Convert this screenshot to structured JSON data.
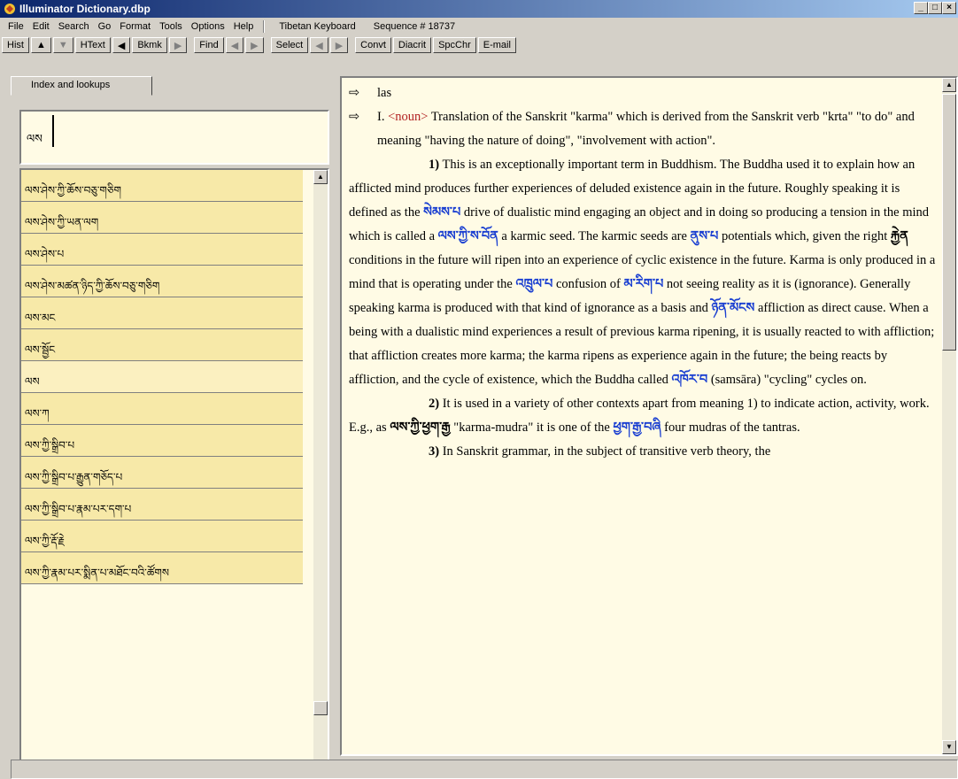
{
  "window": {
    "title": "Illuminator Dictionary.dbp",
    "min": "_",
    "max": "□",
    "close": "×"
  },
  "menu": {
    "items": [
      "File",
      "Edit",
      "Search",
      "Go",
      "Format",
      "Tools",
      "Options",
      "Help"
    ],
    "keyboard": "Tibetan Keyboard",
    "sequence": "Sequence # 18737"
  },
  "toolbar": {
    "hist": "Hist",
    "up": "▲",
    "down": "▼",
    "htext": "HText",
    "back": "◀",
    "bkmk": "Bkmk",
    "fwd": "▶",
    "find": "Find",
    "find_prev": "◀",
    "find_next": "▶",
    "select": "Select",
    "sel_prev": "◀",
    "sel_next": "▶",
    "convt": "Convt",
    "diacrit": "Diacrit",
    "spcchr": "SpcChr",
    "email": "E-mail"
  },
  "left": {
    "tab": "Index and lookups",
    "search_value": "ལས",
    "items": [
      "ལས་ཤེས་ཀྱི་ཆོས་བཅུ་གཅིག",
      "ལས་ཤེས་ཀྱི་ཡན་ལག",
      "ལས་ཤེས་པ",
      "ལས་ཤེས་མཚན་ཉིད་ཀྱི་ཆོས་བཅུ་གཅིག",
      "ལས་མང",
      "ལས་སྦྱོང",
      "ལས",
      "ལས་ཀ",
      "ལས་ཀྱི་སྒྲིབ་པ",
      "ལས་ཀྱི་སྒྲིབ་པ་རྒྱུན་གཅོད་པ",
      "ལས་ཀྱི་སྒྲིབ་པ་རྣམ་པར་དག་པ",
      "ལས་ཀྱི་རྡོ་རྗེ",
      "ལས་ཀྱི་རྣམ་པར་སྨིན་པ་མཐོང་བའི་ཚོགས"
    ]
  },
  "entry": {
    "headword": "las",
    "sense_label": "I.",
    "pos": "<noun>",
    "p1": "Translation of the Sanskrit \"karma\" which is derived from the Sanskrit verb \"krta\" \"to do\" and meaning \"having the nature of doing\", \"involvement with action\".",
    "p2_num": "1)",
    "p2a": "This is an exceptionally important term in Buddhism. The Buddha used it to explain how an afflicted mind produces further experiences of deluded existence again in the future. Roughly speaking it is defined as the",
    "t1": "སེམས་པ",
    "p2b": "drive of dualistic mind engaging an object and in doing so producing a tension in the mind which is called a",
    "t2": "ལས་ཀྱི་ས་བོན",
    "p2c": "a karmic seed. The karmic seeds are",
    "t3": "ནུས་པ",
    "p2d": "potentials which, given the right",
    "t4": "རྐྱེན",
    "p2e": "conditions in the future will ripen into an experience of cyclic existence in the future. Karma is only produced in a mind that is operating under the",
    "t5": "འཁྲུལ་པ",
    "p2f": "confusion of",
    "t6": "མ་རིག་པ",
    "p2g": "not seeing reality as it is (ignorance). Generally speaking karma is produced with that kind of ignorance as a basis and",
    "t7": "ཉོན་མོངས",
    "p2h": "affliction as direct cause. When a being with a dualistic mind experiences a result of previous karma ripening, it is usually reacted to with affliction; that affliction creates more karma; the karma ripens as experience again in the future; the being reacts by affliction, and the cycle of existence, which the Buddha called",
    "t8": "འཁོར་བ",
    "p2i": "(samsāra) \"cycling\" cycles on.",
    "p3_num": "2)",
    "p3a": "It is used in a variety of other contexts apart from meaning 1) to indicate action, activity, work. E.g., as",
    "t9": "ལས་ཀྱི་ཕྱག་རྒྱ",
    "p3b": "\"karma-mudra\" it is one of the",
    "t10": "ཕྱག་རྒྱ་བཞི",
    "p3c": "four mudras of the tantras.",
    "p4_num": "3)",
    "p4a": "In Sanskrit grammar, in the subject of transitive verb theory, the"
  }
}
